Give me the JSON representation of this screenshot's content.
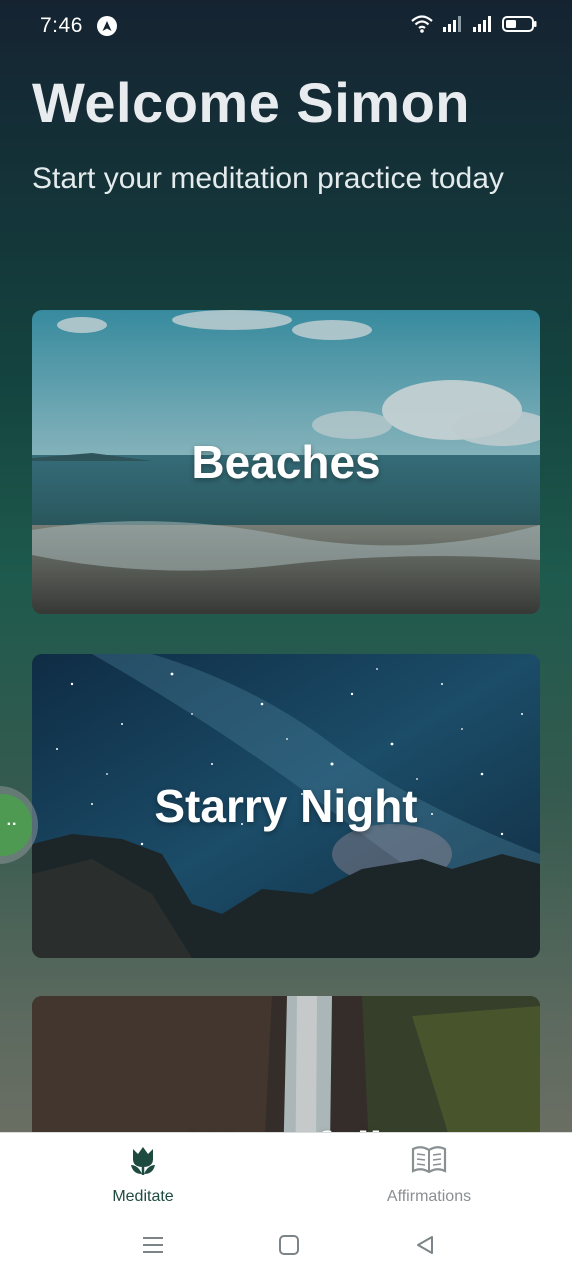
{
  "status_bar": {
    "time": "7:46",
    "icons": [
      "navigation-arrow-icon",
      "wifi-icon",
      "signal-icon",
      "signal-icon",
      "battery-icon"
    ]
  },
  "header": {
    "title": "Welcome Simon",
    "subtitle": "Start your meditation practice today"
  },
  "cards": [
    {
      "title": "Beaches"
    },
    {
      "title": "Starry Night"
    },
    {
      "title": "Waterfall"
    }
  ],
  "floating_bubble": {
    "icon": "more-dots-icon",
    "label": "··"
  },
  "tab_bar": {
    "tabs": [
      {
        "label": "Meditate",
        "icon": "tulip-icon",
        "active": true
      },
      {
        "label": "Affirmations",
        "icon": "book-icon",
        "active": false
      }
    ]
  },
  "system_nav": [
    "menu-icon",
    "home-square-icon",
    "back-triangle-icon"
  ],
  "colors": {
    "active_tab": "#1f4a40",
    "inactive_tab": "#8a9092",
    "bubble": "#4e9a52"
  }
}
